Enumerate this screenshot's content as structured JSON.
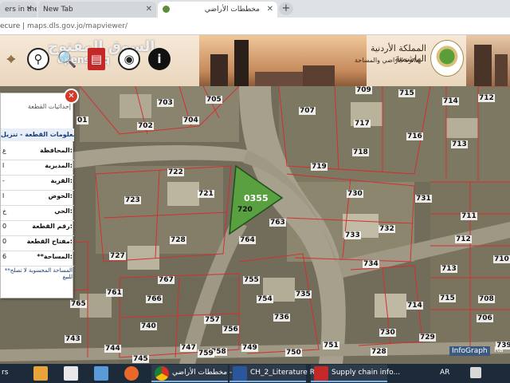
{
  "browser": {
    "tabs": [
      {
        "title": "ers in the"
      },
      {
        "title": "New Tab"
      },
      {
        "title": "مخططات الأراضي"
      }
    ],
    "url_secure": "ecure |",
    "url_host": "maps.dls.gov.jo/mapviewer/"
  },
  "header": {
    "ministry_name": "المملكة الأردنية الهاشمية",
    "ministry_sub": "دائرة الأراضي والمساحة",
    "watermark": "السوق المفتوح",
    "watermark_sub": "opensooq"
  },
  "toolbar": {
    "icons": [
      "pin-map-icon",
      "zoom-icon",
      "book-icon",
      "locate-icon",
      "info-icon"
    ]
  },
  "panel": {
    "coordinates_label": "إحداثيات القطعة",
    "title": "معلومات القطعة - تنزيل",
    "rows": [
      {
        "key": "المحافظة:",
        "value": "ع"
      },
      {
        "key": "المديرية:",
        "value": "ا"
      },
      {
        "key": "القرية:",
        "value": "-"
      },
      {
        "key": "الحوض:",
        "value": "ا"
      },
      {
        "key": "الحي:",
        "value": "خ"
      },
      {
        "key": "رقم القطعة:",
        "value": "0"
      },
      {
        "key": "مفتاح القطعة:",
        "value": "0"
      },
      {
        "key": "**المساحة:",
        "value": "6"
      }
    ],
    "note": "**المساحة المحسوبة لا تصلح للبيع"
  },
  "map": {
    "selected_parcel": "0355",
    "selected_sub": "720",
    "parcels": [
      "703",
      "705",
      "707",
      "709",
      "715",
      "714",
      "712",
      "702",
      "704",
      "717",
      "716",
      "713",
      "01",
      "718",
      "719",
      "722",
      "721",
      "723",
      "730",
      "731",
      "711",
      "728",
      "763",
      "733",
      "732",
      "712",
      "727",
      "764",
      "734",
      "713",
      "710",
      "767",
      "755",
      "735",
      "761",
      "765",
      "766",
      "754",
      "714",
      "715",
      "708",
      "740",
      "757",
      "736",
      "706",
      "743",
      "744",
      "745",
      "747",
      "758",
      "756",
      "749",
      "750",
      "730",
      "729",
      "728",
      "759",
      "751",
      "739"
    ],
    "infograph": "InfoGraph",
    "infograph_tail": "Ra"
  },
  "taskbar": {
    "start_text": "rs",
    "items": [
      {
        "title": "مخططات الأراضي -"
      },
      {
        "title": "CH_2_Literature R..."
      },
      {
        "title": "Supply chain info..."
      }
    ],
    "lang": "AR"
  },
  "colors": {
    "selected_fill": "#58a040",
    "parcel_line": "#d23030",
    "accent_green": "#5a9e3a"
  }
}
